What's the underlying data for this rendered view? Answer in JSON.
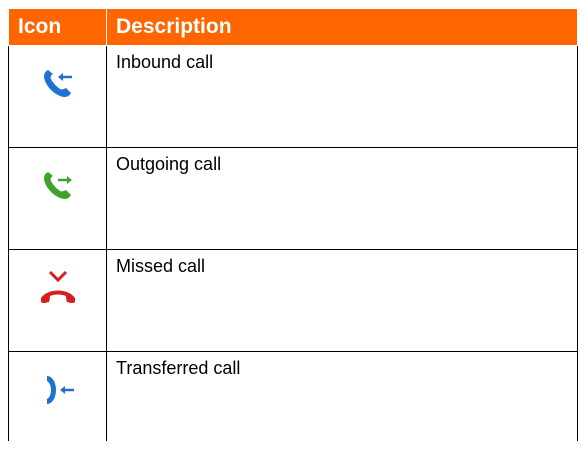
{
  "table": {
    "headers": {
      "icon": "Icon",
      "description": "Description"
    },
    "rows": [
      {
        "icon": "inbound-call-icon",
        "description": "Inbound call",
        "color": "#1e73d2"
      },
      {
        "icon": "outgoing-call-icon",
        "description": "Outgoing call",
        "color": "#3ea22d"
      },
      {
        "icon": "missed-call-icon",
        "description": "Missed call",
        "color": "#d81e1e"
      },
      {
        "icon": "transferred-call-icon",
        "description": "Transferred call",
        "color": "#1e73d2"
      }
    ]
  },
  "colors": {
    "header_background": "#ff6600",
    "header_text": "#ffffff"
  }
}
